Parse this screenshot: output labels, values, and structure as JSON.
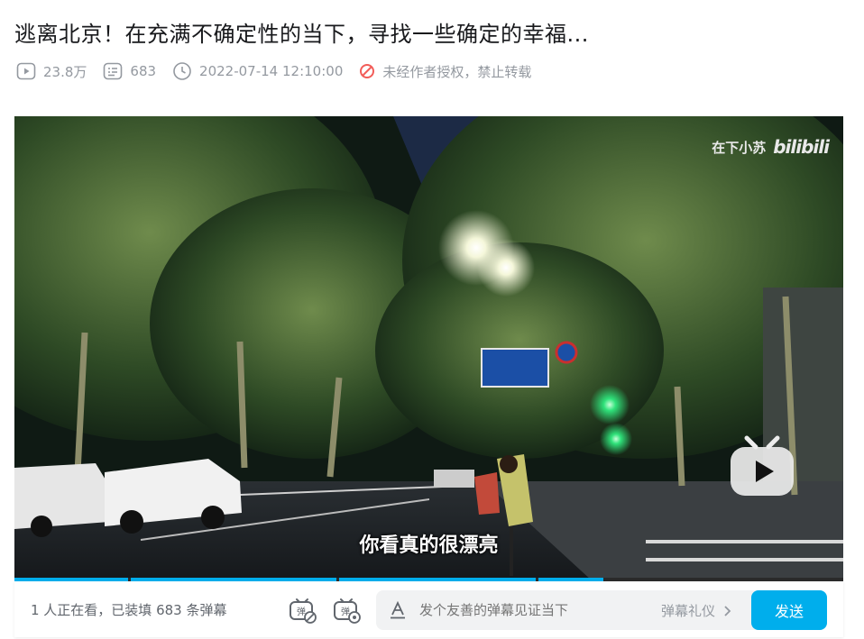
{
  "video": {
    "title": "逃离北京！在充满不确定性的当下，寻找一些确定的幸福...",
    "views": "23.8万",
    "danmaku_count": "683",
    "publish_time": "2022-07-14 12:10:00",
    "copyright_notice": "未经作者授权，禁止转载"
  },
  "player": {
    "watermark_uploader": "在下小苏",
    "watermark_logo": "bilibili",
    "subtitle": "你看真的很漂亮",
    "progress_segments": 4
  },
  "danmaku_bar": {
    "viewers_text": "1 人正在看，已装填 683 条弹幕",
    "input_placeholder": "发个友善的弹幕见证当下",
    "etiquette_label": "弹幕礼仪",
    "send_label": "发送"
  },
  "icons": [
    "play-count-icon",
    "danmaku-count-icon",
    "clock-icon",
    "no-repost-icon",
    "danmaku-toggle-icon",
    "danmaku-settings-icon",
    "text-style-icon",
    "chevron-right-icon",
    "bilibili-tv-icon"
  ],
  "colors": {
    "accent": "#00aeec",
    "meta_text": "#9499a0",
    "warning": "#f25d59",
    "title": "#18191c"
  }
}
